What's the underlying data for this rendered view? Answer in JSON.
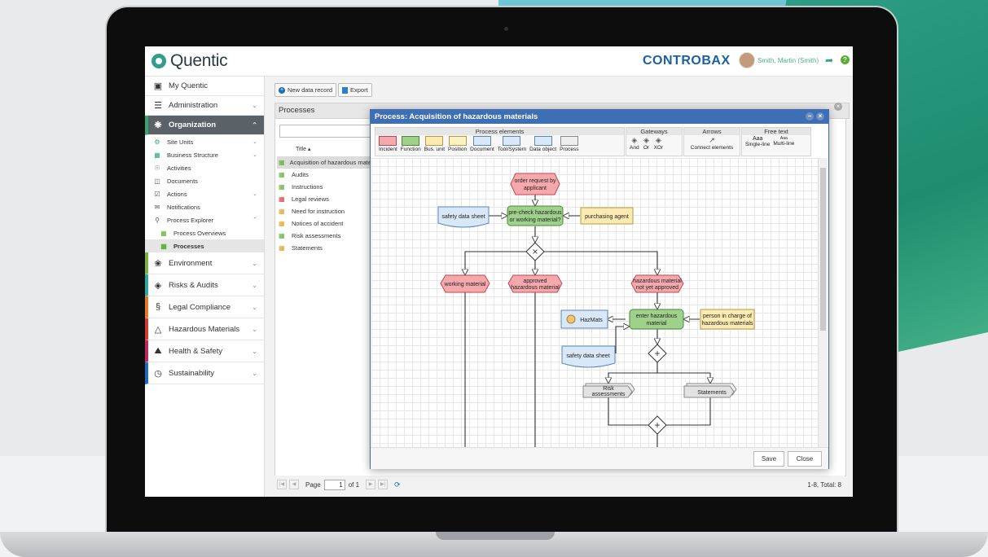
{
  "topbar": {
    "logo_text": "Quentic",
    "brand": "CONTROBAX",
    "user_name": "Smith, Martin (Smith)",
    "help": "?"
  },
  "sidebar": {
    "items": [
      {
        "label": "My Quentic",
        "icon": "user-card-icon"
      },
      {
        "label": "Administration",
        "icon": "menu-lines-icon"
      },
      {
        "label": "Organization",
        "icon": "organization-icon"
      },
      {
        "label": "Site Units",
        "icon": "site-units-icon"
      },
      {
        "label": "Business Structure",
        "icon": "business-structure-icon"
      },
      {
        "label": "Activities",
        "icon": "activities-icon"
      },
      {
        "label": "Documents",
        "icon": "documents-icon"
      },
      {
        "label": "Actions",
        "icon": "actions-icon"
      },
      {
        "label": "Notifications",
        "icon": "notifications-icon"
      },
      {
        "label": "Process Explorer",
        "icon": "process-explorer-icon"
      },
      {
        "label": "Process Overviews",
        "icon": "process-overviews-icon"
      },
      {
        "label": "Processes",
        "icon": "processes-icon"
      },
      {
        "label": "Environment",
        "icon": "environment-icon",
        "color": "#7bb241"
      },
      {
        "label": "Risks & Audits",
        "icon": "risks-icon",
        "color": "#2fa8a0"
      },
      {
        "label": "Legal Compliance",
        "icon": "paragraph-icon",
        "color": "#e07b22"
      },
      {
        "label": "Hazardous Materials",
        "icon": "flask-icon",
        "color": "#d33a2f"
      },
      {
        "label": "Health & Safety",
        "icon": "helmet-icon",
        "color": "#b82a5c"
      },
      {
        "label": "Sustainability",
        "icon": "sustainability-icon",
        "color": "#1e6bb8"
      }
    ]
  },
  "toolbar": {
    "new_label": "New data record",
    "export_label": "Export"
  },
  "list": {
    "panel_title": "Processes",
    "column_title": "Title",
    "rows": [
      "Acquisition of hazardous materials",
      "Audits",
      "Instructions",
      "Legal reviews",
      "Need for instruction",
      "Notices of accident",
      "Risk assessments",
      "Statements"
    ]
  },
  "pager": {
    "page_label": "Page",
    "page_value": "1",
    "of_label": "of 1",
    "total": "1-8, Total: 8"
  },
  "dialog": {
    "title": "Process: Acquisition of hazardous materials",
    "palette": {
      "process_elements": "Process elements",
      "gateways": "Gateways",
      "arrows": "Arrows",
      "free_text": "Free text",
      "elements": [
        {
          "label": "Incident",
          "fill": "#f6a9ad",
          "stroke": "#c0464d"
        },
        {
          "label": "Function",
          "fill": "#9fd08c",
          "stroke": "#4a8a37"
        },
        {
          "label": "Bus. unit",
          "fill": "#fbeab1",
          "stroke": "#b69b3e"
        },
        {
          "label": "Position",
          "fill": "#fbf2c2",
          "stroke": "#b69b3e"
        },
        {
          "label": "Document",
          "fill": "#d8e8f8",
          "stroke": "#5d86b8"
        },
        {
          "label": "Tool/System",
          "fill": "#d8e8f8",
          "stroke": "#5d86b8"
        },
        {
          "label": "Data object",
          "fill": "#d8e8f8",
          "stroke": "#5d86b8"
        },
        {
          "label": "Process",
          "fill": "#eeeeee",
          "stroke": "#888888"
        }
      ],
      "gateways_items": [
        "And",
        "Or",
        "XOr"
      ],
      "arrow_item": "Connect elements",
      "text_items": [
        "Single-line",
        "Multi-line"
      ],
      "text_sample": "Aaa"
    },
    "diagram": {
      "order_request": [
        "order request by",
        "applicant"
      ],
      "precheck": [
        "pre-check hazardous",
        "or working material?"
      ],
      "sds1": "safety data sheet",
      "purchasing": "purchasing agent",
      "working_material": "working material",
      "approved": [
        "approved",
        "hazardous material"
      ],
      "not_approved": [
        "hazardous material",
        "not yet approved"
      ],
      "hazmats": "HazMats",
      "enter": [
        "enter hazardous",
        "material"
      ],
      "person": [
        "person in charge of",
        "hazardous materials"
      ],
      "sds2": "safety data sheet",
      "risk": [
        "Risk",
        "assessments"
      ],
      "statements": "Statements"
    },
    "save_label": "Save",
    "close_label": "Close"
  }
}
